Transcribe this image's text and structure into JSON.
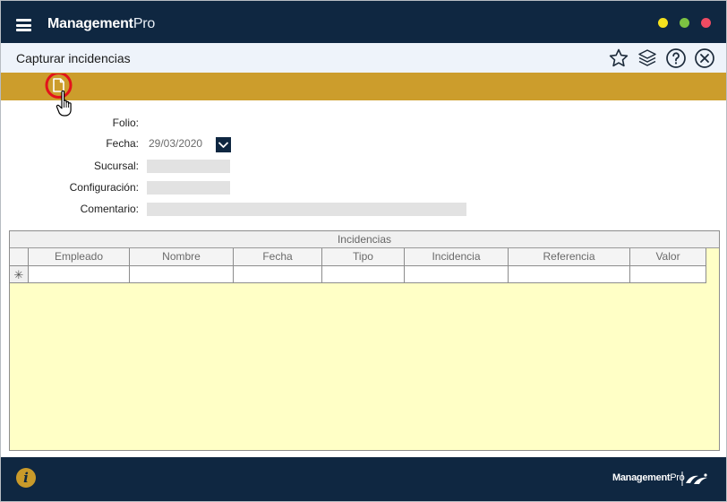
{
  "app": {
    "title_bold": "Management",
    "title_light": "Pro",
    "window_controls": [
      {
        "name": "minimize",
        "color": "#f5e11d"
      },
      {
        "name": "maximize",
        "color": "#7cc242"
      },
      {
        "name": "close",
        "color": "#ee4b62"
      }
    ]
  },
  "header": {
    "title": "Capturar incidencias",
    "icons": [
      "star-icon",
      "layers-icon",
      "help-icon",
      "close-circle-icon"
    ]
  },
  "toolbar": {
    "buttons": [
      "new-document-icon"
    ]
  },
  "form": {
    "folio_label": "Folio:",
    "folio_value": "",
    "fecha_label": "Fecha:",
    "fecha_value": "29/03/2020",
    "sucursal_label": "Sucursal:",
    "sucursal_value": "",
    "configuracion_label": "Configuración:",
    "configuracion_value": "",
    "comentario_label": "Comentario:",
    "comentario_value": ""
  },
  "grid": {
    "caption": "Incidencias",
    "columns": [
      "Empleado",
      "Nombre",
      "Fecha",
      "Tipo",
      "Incidencia",
      "Referencia",
      "Valor"
    ],
    "new_row_marker": "✳"
  },
  "footer": {
    "info_label": "i",
    "brand_bold": "Management",
    "brand_light": "Pro"
  },
  "colors": {
    "navy": "#0f2741",
    "gold": "#cc9d2c",
    "header_bg": "#eef3fa",
    "grid_bg": "#ffffc6",
    "highlight_ring": "#e3121b"
  }
}
